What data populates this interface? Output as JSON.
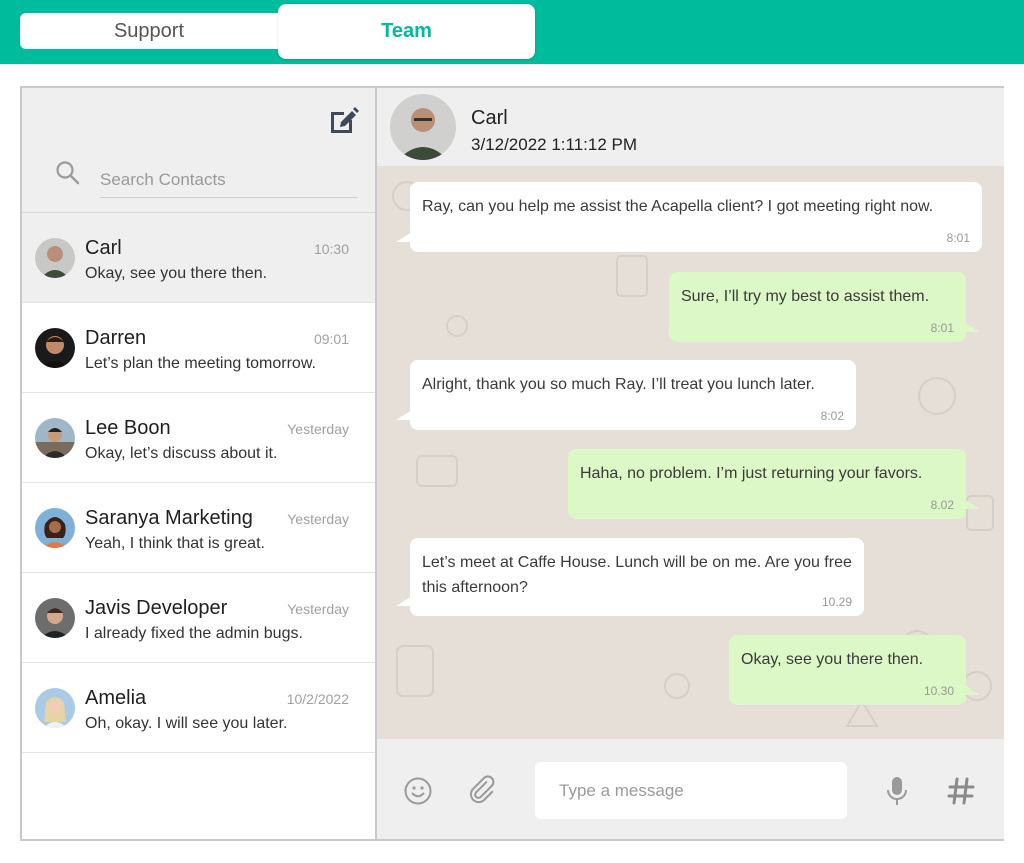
{
  "tabs": [
    {
      "label": "Support",
      "active": false
    },
    {
      "label": "Team",
      "active": true
    }
  ],
  "colors": {
    "accent": "#00bb9c",
    "incoming": "#ffffff",
    "outgoing": "#dcf8c6",
    "chat_bg": "#e6dfd7"
  },
  "sidebar": {
    "compose_icon": "compose-icon",
    "search": {
      "placeholder": "Search Contacts",
      "value": ""
    },
    "contacts": [
      {
        "name": "Carl",
        "message": "Okay, see you there then.",
        "time": "10:30",
        "active": true
      },
      {
        "name": "Darren",
        "message": "Let’s plan the meeting tomorrow.",
        "time": "09:01",
        "active": false
      },
      {
        "name": "Lee Boon",
        "message": "Okay, let’s discuss about it.",
        "time": "Yesterday",
        "active": false
      },
      {
        "name": "Saranya Marketing",
        "message": "Yeah, I think that is great.",
        "time": "Yesterday",
        "active": false
      },
      {
        "name": "Javis Developer",
        "message": "I already fixed the admin bugs.",
        "time": "Yesterday",
        "active": false
      },
      {
        "name": "Amelia",
        "message": "Oh, okay. I will see you later.",
        "time": "10/2/2022",
        "active": false
      }
    ]
  },
  "chat": {
    "name": "Carl",
    "timestamp": "3/12/2022 1:11:12 PM",
    "messages": [
      {
        "direction": "in",
        "text": "Ray, can you help me assist the Acapella client? I got meeting right now.",
        "time": "8:01"
      },
      {
        "direction": "out",
        "text": "Sure, I’ll try my best to assist them.",
        "time": "8:01"
      },
      {
        "direction": "in",
        "text": "Alright, thank you so much Ray. I’ll treat you lunch later.",
        "time": "8:02"
      },
      {
        "direction": "out",
        "text": "Haha, no problem. I’m just returning your favors.",
        "time": "8.02"
      },
      {
        "direction": "in",
        "text": "Let’s meet at Caffe House. Lunch will be on me. Are you free this afternoon?",
        "time": "10.29"
      },
      {
        "direction": "out",
        "text": "Okay, see you there then.",
        "time": "10.30"
      }
    ],
    "composer": {
      "placeholder": "Type a message",
      "value": "",
      "icons": [
        "emoji-icon",
        "attachment-icon",
        "microphone-icon",
        "hashtag-icon"
      ]
    }
  }
}
